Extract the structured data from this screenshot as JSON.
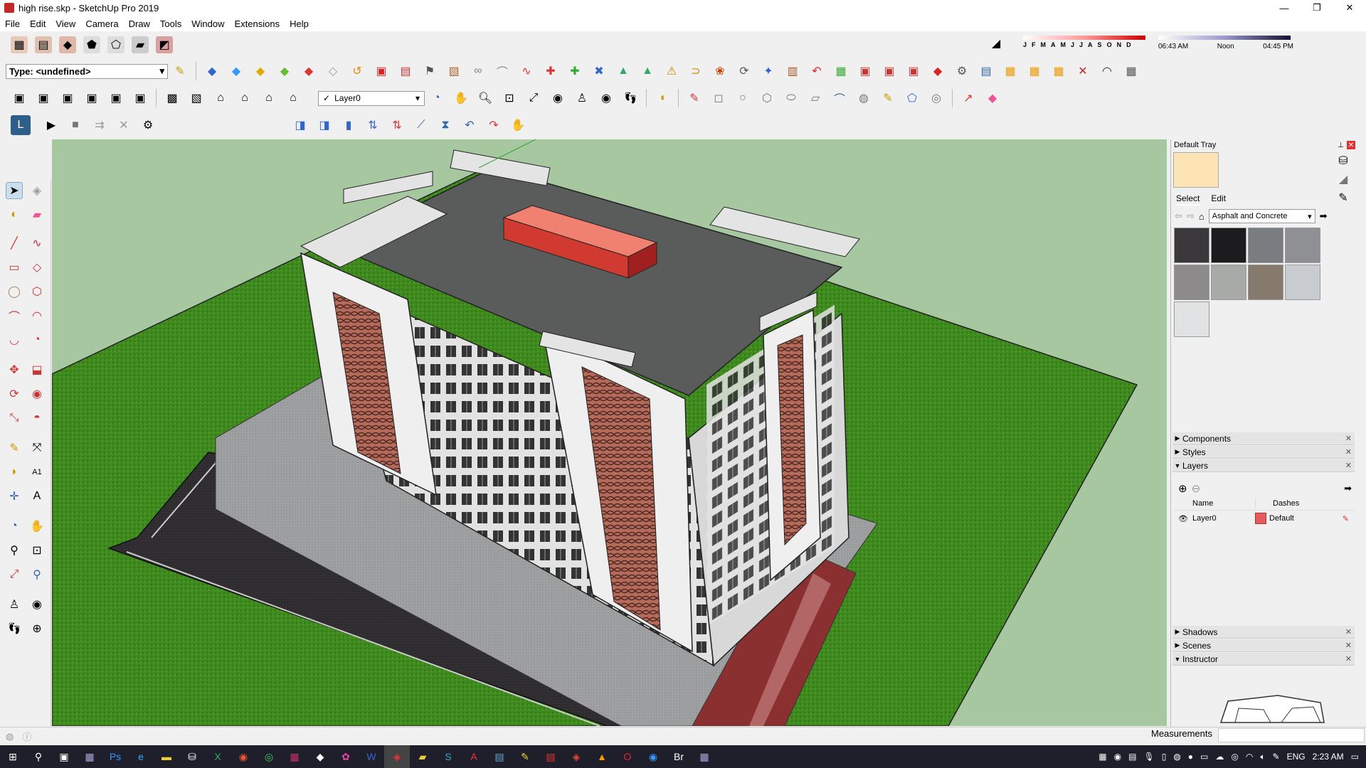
{
  "window": {
    "title": "high rise.skp - SketchUp Pro 2019",
    "minimize": "—",
    "maximize": "❐",
    "close": "✕"
  },
  "menu": [
    "File",
    "Edit",
    "View",
    "Camera",
    "Draw",
    "Tools",
    "Window",
    "Extensions",
    "Help"
  ],
  "toolbar": {
    "type_label": "Type: <undefined>",
    "layer_value": "Layer0",
    "layer_check": "✓"
  },
  "shadow": {
    "months": [
      "J",
      "F",
      "M",
      "A",
      "M",
      "J",
      "J",
      "A",
      "S",
      "O",
      "N",
      "D"
    ],
    "time_start": "06:43 AM",
    "time_mid": "Noon",
    "time_end": "04:45 PM"
  },
  "tray": {
    "title": "Default Tray",
    "tabs": {
      "select": "Select",
      "edit": "Edit"
    },
    "material_library": "Asphalt and Concrete",
    "material_swatches": [
      "#3a383a",
      "#1c1c1e",
      "#7a7d80",
      "#8e9094",
      "#8c8a8a",
      "#a8aaa8",
      "#867a6c",
      "#c8ccd0",
      "#e0e2e4"
    ],
    "selected_color": "#fde4b4",
    "panels": {
      "components": "Components",
      "styles": "Styles",
      "layers": "Layers",
      "shadows": "Shadows",
      "scenes": "Scenes",
      "instructor": "Instructor"
    },
    "layers": {
      "col_name": "Name",
      "col_dashes": "Dashes",
      "rows": [
        {
          "name": "Layer0",
          "dashes": "Default",
          "color": "#e55a5a"
        }
      ]
    }
  },
  "status": {
    "measurements": "Measurements"
  },
  "taskbar": {
    "lang": "ENG",
    "time": "2:23 AM"
  }
}
